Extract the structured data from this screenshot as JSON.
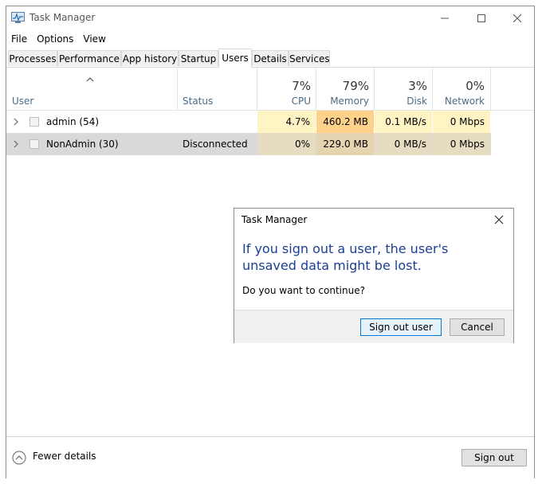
{
  "window": {
    "title": "Task Manager",
    "accent_color": "#0078d7"
  },
  "menu": [
    "File",
    "Options",
    "View"
  ],
  "tabs": [
    {
      "label": "Processes",
      "active": false
    },
    {
      "label": "Performance",
      "active": false
    },
    {
      "label": "App history",
      "active": false
    },
    {
      "label": "Startup",
      "active": false
    },
    {
      "label": "Users",
      "active": true
    },
    {
      "label": "Details",
      "active": false
    },
    {
      "label": "Services",
      "active": false
    }
  ],
  "columns": {
    "user": "User",
    "status": "Status",
    "cpu": {
      "percent": "7%",
      "label": "CPU"
    },
    "memory": {
      "percent": "79%",
      "label": "Memory"
    },
    "disk": {
      "percent": "3%",
      "label": "Disk"
    },
    "network": {
      "percent": "0%",
      "label": "Network"
    }
  },
  "rows": [
    {
      "name": "admin (54)",
      "status": "",
      "cpu": "4.7%",
      "memory": "460.2 MB",
      "disk": "0.1 MB/s",
      "network": "0 Mbps",
      "selected": false
    },
    {
      "name": "NonAdmin (30)",
      "status": "Disconnected",
      "cpu": "0%",
      "memory": "229.0 MB",
      "disk": "0 MB/s",
      "network": "0 Mbps",
      "selected": true
    }
  ],
  "heat_colors": {
    "row0": {
      "cpu": "#fff4c4",
      "memory": "#ffd28c",
      "disk": "#fff4c4",
      "network": "#fff4c4"
    },
    "row1": {
      "cpu": "#e6dcc2",
      "memory": "#e6d4b0",
      "disk": "#e6dcc2",
      "network": "#e6dcc2"
    }
  },
  "footer": {
    "fewer_details": "Fewer details",
    "sign_out": "Sign out"
  },
  "dialog": {
    "title": "Task Manager",
    "heading": "If you sign out a user, the user's unsaved data might be lost.",
    "question": "Do you want to continue?",
    "confirm": "Sign out user",
    "cancel": "Cancel",
    "heading_color": "#1b3f94"
  },
  "icons": {
    "app": "task-manager-icon",
    "minimize": "minimize-icon",
    "maximize": "maximize-icon",
    "close": "close-icon",
    "sort": "chevron-up-icon",
    "expand": "chevron-right-icon",
    "user": "user-icon",
    "fewer": "chevron-up-circle-icon"
  }
}
